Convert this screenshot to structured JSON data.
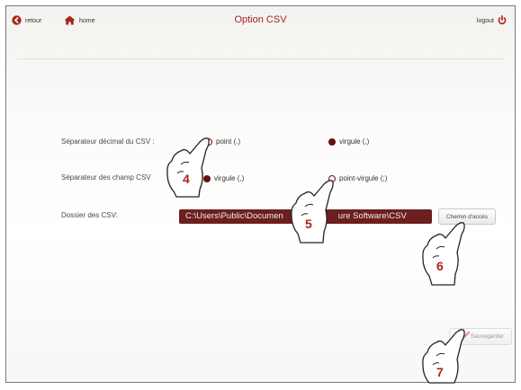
{
  "header": {
    "back_label": "retour",
    "home_label": "home",
    "title": "Option CSV",
    "logout_label": "logout"
  },
  "form": {
    "decimal_separator": {
      "label": "Séparateur décimal du CSV :",
      "options": [
        "point (.)",
        "virgule (,)"
      ],
      "selected": "virgule (,)"
    },
    "field_separator": {
      "label": "Séparateur des champ CSV",
      "options": [
        "virgule (,)",
        "point-virgule (;)"
      ],
      "selected": "virgule (,)"
    },
    "folder": {
      "label": "Dossier des CSV:",
      "value": "C:\\Users\\Public\\Documen",
      "value_tail": "ure Software\\CSV",
      "browse_label": "Chemin d'accès"
    },
    "save_label": "Sauvegarder"
  },
  "callouts": [
    "4",
    "5",
    "6",
    "7"
  ],
  "colors": {
    "accent": "#a7261d",
    "radio_fill": "#6a1010",
    "path_box": "#6b1f1f"
  }
}
